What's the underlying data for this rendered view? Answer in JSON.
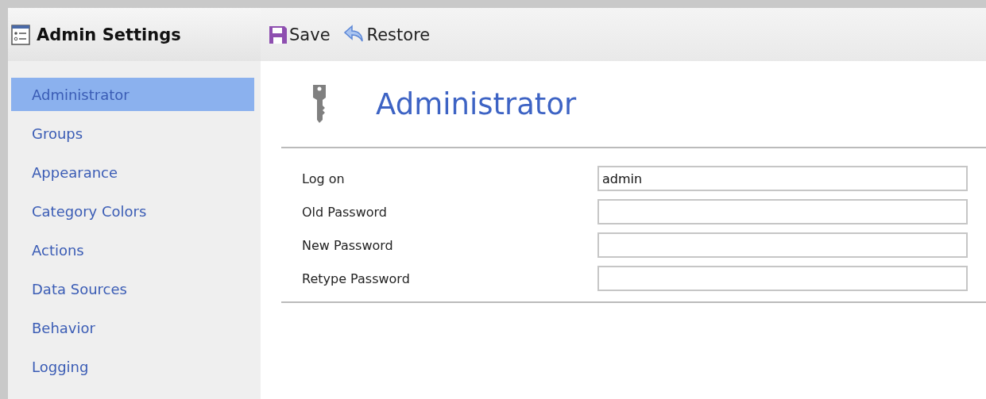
{
  "window": {
    "title": "Admin Settings"
  },
  "toolbar": [
    {
      "kind": "save",
      "label": "Save"
    },
    {
      "kind": "restore",
      "label": "Restore"
    }
  ],
  "sidebar": {
    "items": [
      {
        "label": "Administrator",
        "selected": true
      },
      {
        "label": "Groups",
        "selected": false
      },
      {
        "label": "Appearance",
        "selected": false
      },
      {
        "label": "Category Colors",
        "selected": false
      },
      {
        "label": "Actions",
        "selected": false
      },
      {
        "label": "Data Sources",
        "selected": false
      },
      {
        "label": "Behavior",
        "selected": false
      },
      {
        "label": "Logging",
        "selected": false
      }
    ]
  },
  "page": {
    "title": "Administrator",
    "fields": [
      {
        "label": "Log on",
        "value": "admin"
      },
      {
        "label": "Old Password"
      },
      {
        "label": "New Password"
      },
      {
        "label": "Retype Password"
      }
    ]
  }
}
